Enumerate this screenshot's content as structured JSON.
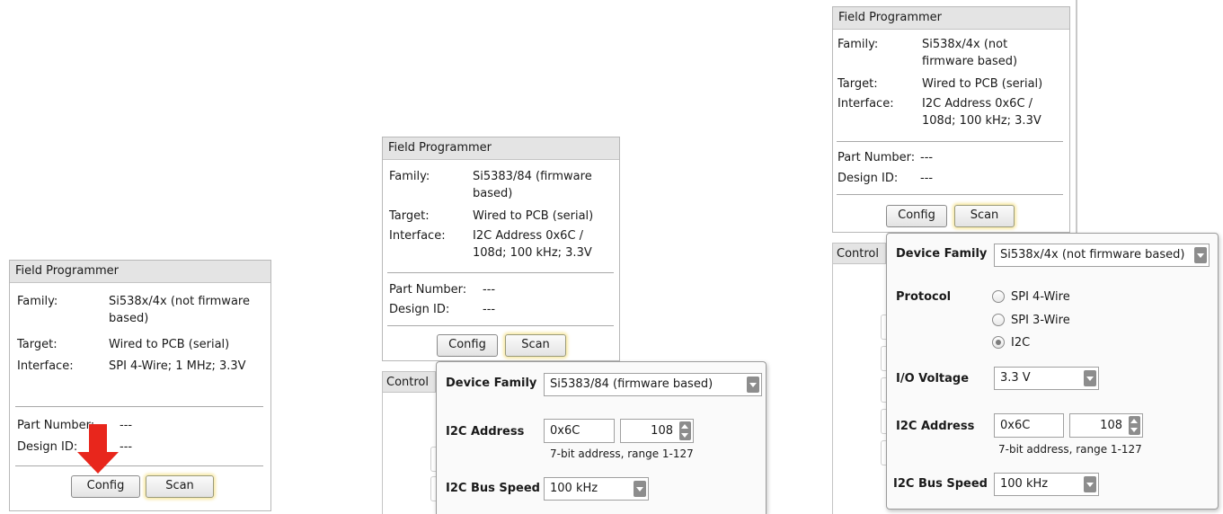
{
  "panel1": {
    "title": "Field Programmer",
    "family_label": "Family:",
    "family_value": "Si538x/4x (not firmware based)",
    "target_label": "Target:",
    "target_value": "Wired to PCB (serial)",
    "interface_label": "Interface:",
    "interface_value": "SPI 4-Wire; 1 MHz; 3.3V",
    "part_label": "Part Number:",
    "part_value": "---",
    "design_label": "Design ID:",
    "design_value": "---",
    "config_label": "Config",
    "scan_label": "Scan",
    "arrow_color": "#e8261c"
  },
  "panel2": {
    "title": "Field Programmer",
    "family_label": "Family:",
    "family_value": "Si5383/84 (firmware based)",
    "target_label": "Target:",
    "target_value": "Wired to PCB (serial)",
    "interface_label": "Interface:",
    "interface_value": "I2C Address 0x6C / 108d; 100 kHz; 3.3V",
    "part_label": "Part Number:",
    "part_value": "---",
    "design_label": "Design ID:",
    "design_value": "---",
    "config_label": "Config",
    "scan_label": "Scan",
    "control_label": "Control",
    "popup": {
      "device_family_label": "Device Family",
      "device_family_value": "Si5383/84 (firmware based)",
      "i2c_address_label": "I2C Address",
      "i2c_address_hex": "0x6C",
      "i2c_address_dec": "108",
      "i2c_address_hint": "7-bit address, range 1-127",
      "bus_speed_label": "I2C Bus Speed",
      "bus_speed_value": "100 kHz"
    }
  },
  "panel3": {
    "title": "Field Programmer",
    "family_label": "Family:",
    "family_value": "Si538x/4x (not firmware based)",
    "target_label": "Target:",
    "target_value": "Wired to PCB (serial)",
    "interface_label": "Interface:",
    "interface_value": "I2C Address 0x6C / 108d; 100 kHz; 3.3V",
    "part_label": "Part Number:",
    "part_value": "---",
    "design_label": "Design ID:",
    "design_value": "---",
    "config_label": "Config",
    "scan_label": "Scan",
    "control_label": "Control",
    "popup": {
      "device_family_label": "Device Family",
      "device_family_value": "Si538x/4x (not firmware based)",
      "protocol_label": "Protocol",
      "protocol_options": [
        "SPI 4-Wire",
        "SPI 3-Wire",
        "I2C"
      ],
      "protocol_selected": "I2C",
      "io_voltage_label": "I/O Voltage",
      "io_voltage_value": "3.3 V",
      "i2c_address_label": "I2C Address",
      "i2c_address_hex": "0x6C",
      "i2c_address_dec": "108",
      "i2c_address_hint": "7-bit address, range 1-127",
      "bus_speed_label": "I2C Bus Speed",
      "bus_speed_value": "100 kHz"
    }
  }
}
